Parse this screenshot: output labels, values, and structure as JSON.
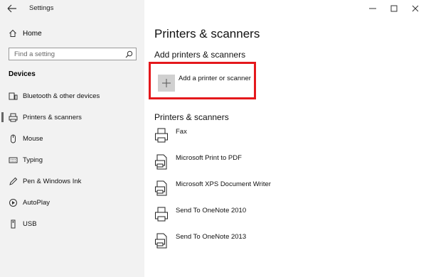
{
  "window": {
    "title": "Settings",
    "controls": [
      "minimize-icon",
      "maximize-icon",
      "close-icon"
    ]
  },
  "sidebar": {
    "home_label": "Home",
    "search_placeholder": "Find a setting",
    "section_title": "Devices",
    "items": [
      {
        "label": "Bluetooth & other devices",
        "icon": "bluetooth-device-icon"
      },
      {
        "label": "Printers & scanners",
        "icon": "printer-icon",
        "active": true
      },
      {
        "label": "Mouse",
        "icon": "mouse-icon"
      },
      {
        "label": "Typing",
        "icon": "keyboard-icon"
      },
      {
        "label": "Pen & Windows Ink",
        "icon": "pen-icon"
      },
      {
        "label": "AutoPlay",
        "icon": "autoplay-icon"
      },
      {
        "label": "USB",
        "icon": "usb-icon"
      }
    ]
  },
  "main": {
    "title": "Printers & scanners",
    "add_section_title": "Add printers & scanners",
    "add_button_label": "Add a printer or scanner",
    "list_section_title": "Printers & scanners",
    "printers": [
      {
        "label": "Fax",
        "icon": "fax-printer-icon"
      },
      {
        "label": "Microsoft Print to PDF",
        "icon": "document-printer-icon"
      },
      {
        "label": "Microsoft XPS Document Writer",
        "icon": "document-printer-icon"
      },
      {
        "label": "Send To OneNote 2010",
        "icon": "printer-icon"
      },
      {
        "label": "Send To OneNote 2013",
        "icon": "document-printer-icon"
      }
    ]
  },
  "colors": {
    "sidebar_bg": "#f2f2f2",
    "highlight_border": "#e4181c",
    "add_tile_bg": "#d0d0d0"
  }
}
